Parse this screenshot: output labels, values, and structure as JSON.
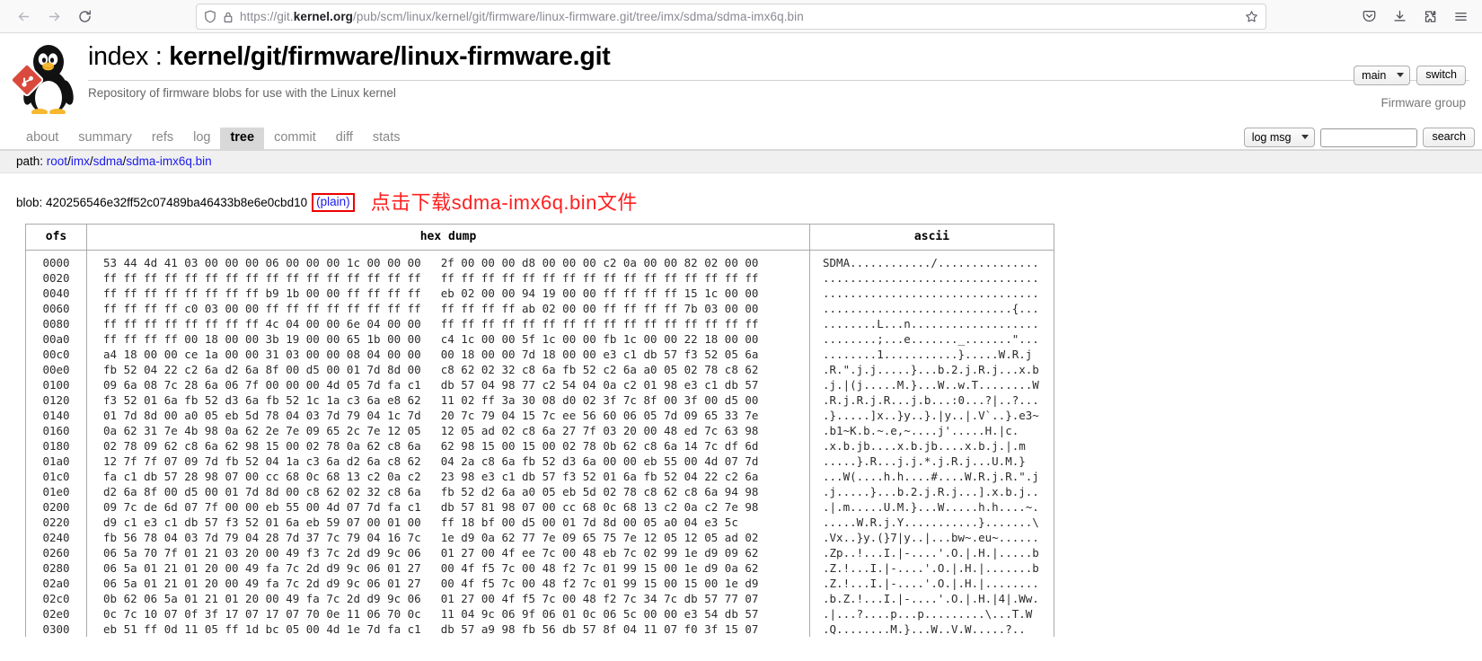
{
  "browser": {
    "nav": {
      "back_icon": "arrow-left-icon",
      "forward_icon": "arrow-right-icon",
      "reload_icon": "reload-icon"
    },
    "urlbar": {
      "shield_icon": "shield-icon",
      "lock_icon": "padlock-icon",
      "scheme": "https://",
      "host_pre": "git.",
      "host_bold": "kernel.org",
      "path": "/pub/scm/linux/kernel/git/firmware/linux-firmware.git/tree/imx/sdma/sdma-imx6q.bin",
      "full_url": "https://git.kernel.org/pub/scm/linux/kernel/git/firmware/linux-firmware.git/tree/imx/sdma/sdma-imx6q.bin",
      "bookmark_icon": "bookmark-star-icon"
    },
    "toolbar_icons": [
      {
        "name": "pocket-icon"
      },
      {
        "name": "downloads-icon"
      },
      {
        "name": "extensions-puzzle-icon"
      },
      {
        "name": "app-menu-hamburger-icon"
      }
    ]
  },
  "site": {
    "logo_icon": "tux-git-logo-icon",
    "title_prefix": "index : ",
    "title_repo": "kernel/git/firmware/linux-firmware.git",
    "description": "Repository of firmware blobs for use with the Linux kernel",
    "branch_selected": "main",
    "switch_label": "switch",
    "owner_label": "Firmware group"
  },
  "tabs": [
    {
      "label": "about",
      "active": false
    },
    {
      "label": "summary",
      "active": false
    },
    {
      "label": "refs",
      "active": false
    },
    {
      "label": "log",
      "active": false
    },
    {
      "label": "tree",
      "active": true
    },
    {
      "label": "commit",
      "active": false
    },
    {
      "label": "diff",
      "active": false
    },
    {
      "label": "stats",
      "active": false
    }
  ],
  "search": {
    "scope_selected": "log msg",
    "query_value": "",
    "placeholder": "",
    "button_label": "search"
  },
  "path": {
    "label": "path:",
    "segments": [
      "root",
      "imx",
      "sdma",
      "sdma-imx6q.bin"
    ]
  },
  "blob": {
    "label": "blob:",
    "hash": "420256546e32ff52c07489ba46433b8e6e0cbd10",
    "plain_link": "(plain)",
    "annotation": "点击下载sdma-imx6q.bin文件",
    "annotation_color": "#ff2020",
    "box_color": "#ee0000"
  },
  "hexdump": {
    "columns": [
      "ofs",
      "hex dump",
      "ascii"
    ],
    "rows": [
      {
        "ofs": "0000",
        "hex_left": "53 44 4d 41 03 00 00 00 06 00 00 00 1c 00 00 00",
        "hex_right": "2f 00 00 00 d8 00 00 00 c2 0a 00 00 82 02 00 00",
        "ascii": "SDMA............/..............."
      },
      {
        "ofs": "0020",
        "hex_left": "ff ff ff ff ff ff ff ff ff ff ff ff ff ff ff ff",
        "hex_right": "ff ff ff ff ff ff ff ff ff ff ff ff ff ff ff ff",
        "ascii": "................................"
      },
      {
        "ofs": "0040",
        "hex_left": "ff ff ff ff ff ff ff ff b9 1b 00 00 ff ff ff ff",
        "hex_right": "eb 02 00 00 94 19 00 00 ff ff ff ff 15 1c 00 00",
        "ascii": "................................"
      },
      {
        "ofs": "0060",
        "hex_left": "ff ff ff ff c0 03 00 00 ff ff ff ff ff ff ff ff",
        "hex_right": "ff ff ff ff ab 02 00 00 ff ff ff ff 7b 03 00 00",
        "ascii": "............................{..."
      },
      {
        "ofs": "0080",
        "hex_left": "ff ff ff ff ff ff ff ff 4c 04 00 00 6e 04 00 00",
        "hex_right": "ff ff ff ff ff ff ff ff ff ff ff ff ff ff ff ff",
        "ascii": "........L...n..................."
      },
      {
        "ofs": "00a0",
        "hex_left": "ff ff ff ff 00 18 00 00 3b 19 00 00 65 1b 00 00",
        "hex_right": "c4 1c 00 00 5f 1c 00 00 fb 1c 00 00 22 18 00 00",
        "ascii": "........;...e......._.......\"..."
      },
      {
        "ofs": "00c0",
        "hex_left": "a4 18 00 00 ce 1a 00 00 31 03 00 00 08 04 00 00",
        "hex_right": "00 18 00 00 7d 18 00 00 e3 c1 db 57 f3 52 05 6a",
        "ascii": "........1...........}.....W.R.j"
      },
      {
        "ofs": "00e0",
        "hex_left": "fb 52 04 22 c2 6a d2 6a 8f 00 d5 00 01 7d 8d 00",
        "hex_right": "c8 62 02 32 c8 6a fb 52 c2 6a a0 05 02 78 c8 62",
        "ascii": ".R.\".j.j.....}...b.2.j.R.j...x.b"
      },
      {
        "ofs": "0100",
        "hex_left": "09 6a 08 7c 28 6a 06 7f 00 00 00 4d 05 7d fa c1",
        "hex_right": "db 57 04 98 77 c2 54 04 0a c2 01 98 e3 c1 db 57",
        "ascii": ".j.|(j.....M.}...W..w.T........W"
      },
      {
        "ofs": "0120",
        "hex_left": "f3 52 01 6a fb 52 d3 6a fb 52 1c 1a c3 6a e8 62",
        "hex_right": "11 02 ff 3a 30 08 d0 02 3f 7c 8f 00 3f 00 d5 00",
        "ascii": ".R.j.R.j.R...j.b...:0...?|..?..."
      },
      {
        "ofs": "0140",
        "hex_left": "01 7d 8d 00 a0 05 eb 5d 78 04 03 7d 79 04 1c 7d",
        "hex_right": "20 7c 79 04 15 7c ee 56 60 06 05 7d 09 65 33 7e",
        "ascii": ".}.....]x..}y..}.|y..|.V`..}.e3~"
      },
      {
        "ofs": "0160",
        "hex_left": "0a 62 31 7e 4b 98 0a 62 2e 7e 09 65 2c 7e 12 05",
        "hex_right": "12 05 ad 02 c8 6a 27 7f 03 20 00 48 ed 7c 63 98",
        "ascii": ".b1~K.b.~.e,~....j'.....H.|c."
      },
      {
        "ofs": "0180",
        "hex_left": "02 78 09 62 c8 6a 62 98 15 00 02 78 0a 62 c8 6a",
        "hex_right": "62 98 15 00 15 00 02 78 0b 62 c8 6a 14 7c df 6d",
        "ascii": ".x.b.jb....x.b.jb....x.b.j.|.m"
      },
      {
        "ofs": "01a0",
        "hex_left": "12 7f 7f 07 09 7d fb 52 04 1a c3 6a d2 6a c8 62",
        "hex_right": "04 2a c8 6a fb 52 d3 6a 00 00 eb 55 00 4d 07 7d",
        "ascii": ".....}.R...j.j.*.j.R.j...U.M.}"
      },
      {
        "ofs": "01c0",
        "hex_left": "fa c1 db 57 28 98 07 00 cc 68 0c 68 13 c2 0a c2",
        "hex_right": "23 98 e3 c1 db 57 f3 52 01 6a fb 52 04 22 c2 6a",
        "ascii": "...W(....h.h....#....W.R.j.R.\".j"
      },
      {
        "ofs": "01e0",
        "hex_left": "d2 6a 8f 00 d5 00 01 7d 8d 00 c8 62 02 32 c8 6a",
        "hex_right": "fb 52 d2 6a a0 05 eb 5d 02 78 c8 62 c8 6a 94 98",
        "ascii": ".j.....}...b.2.j.R.j...].x.b.j.."
      },
      {
        "ofs": "0200",
        "hex_left": "09 7c de 6d 07 7f 00 00 eb 55 00 4d 07 7d fa c1",
        "hex_right": "db 57 81 98 07 00 cc 68 0c 68 13 c2 0a c2 7e 98",
        "ascii": ".|.m.....U.M.}...W.....h.h....~."
      },
      {
        "ofs": "0220",
        "hex_left": "d9 c1 e3 c1 db 57 f3 52 01 6a eb 59 07 00 01 00",
        "hex_right": "ff 18 bf 00 d5 00 01 7d 8d 00 05 a0 04 e3 5c",
        "ascii": ".....W.R.j.Y...........}.......\\"
      },
      {
        "ofs": "0240",
        "hex_left": "fb 56 78 04 03 7d 79 04 28 7d 37 7c 79 04 16 7c",
        "hex_right": "1e d9 0a 62 77 7e 09 65 75 7e 12 05 12 05 ad 02",
        "ascii": ".Vx..}y.(}7|y..|...bw~.eu~......"
      },
      {
        "ofs": "0260",
        "hex_left": "06 5a 70 7f 01 21 03 20 00 49 f3 7c 2d d9 9c 06",
        "hex_right": "01 27 00 4f ee 7c 00 48 eb 7c 02 99 1e d9 09 62",
        "ascii": ".Zp..!...I.|-....'.O.|.H.|.....b"
      },
      {
        "ofs": "0280",
        "hex_left": "06 5a 01 21 01 20 00 49 fa 7c 2d d9 9c 06 01 27",
        "hex_right": "00 4f f5 7c 00 48 f2 7c 01 99 15 00 1e d9 0a 62",
        "ascii": ".Z.!...I.|-....'.O.|.H.|.......b"
      },
      {
        "ofs": "02a0",
        "hex_left": "06 5a 01 21 01 20 00 49 fa 7c 2d d9 9c 06 01 27",
        "hex_right": "00 4f f5 7c 00 48 f2 7c 01 99 15 00 15 00 1e d9",
        "ascii": ".Z.!...I.|-....'.O.|.H.|........"
      },
      {
        "ofs": "02c0",
        "hex_left": "0b 62 06 5a 01 21 01 20 00 49 fa 7c 2d d9 9c 06",
        "hex_right": "01 27 00 4f f5 7c 00 48 f2 7c 34 7c db 57 77 07",
        "ascii": ".b.Z.!...I.|-....'.O.|.H.|4|.Ww."
      },
      {
        "ofs": "02e0",
        "hex_left": "0c 7c 10 07 0f 3f 17 07 17 07 70 0e 11 06 70 0c",
        "hex_right": "11 04 9c 06 9f 06 01 0c 06 5c 00 00 e3 54 db 57",
        "ascii": ".|...?....p...p.........\\...T.W"
      },
      {
        "ofs": "0300",
        "hex_left": "eb 51 ff 0d 11 05 ff 1d bc 05 00 4d 1e 7d fa c1",
        "hex_right": "db 57 a9 98 fb 56 db 57 8f 04 11 07 f0 3f 15 07",
        "ascii": ".Q........M.}...W..V.W.....?.."
      }
    ]
  }
}
